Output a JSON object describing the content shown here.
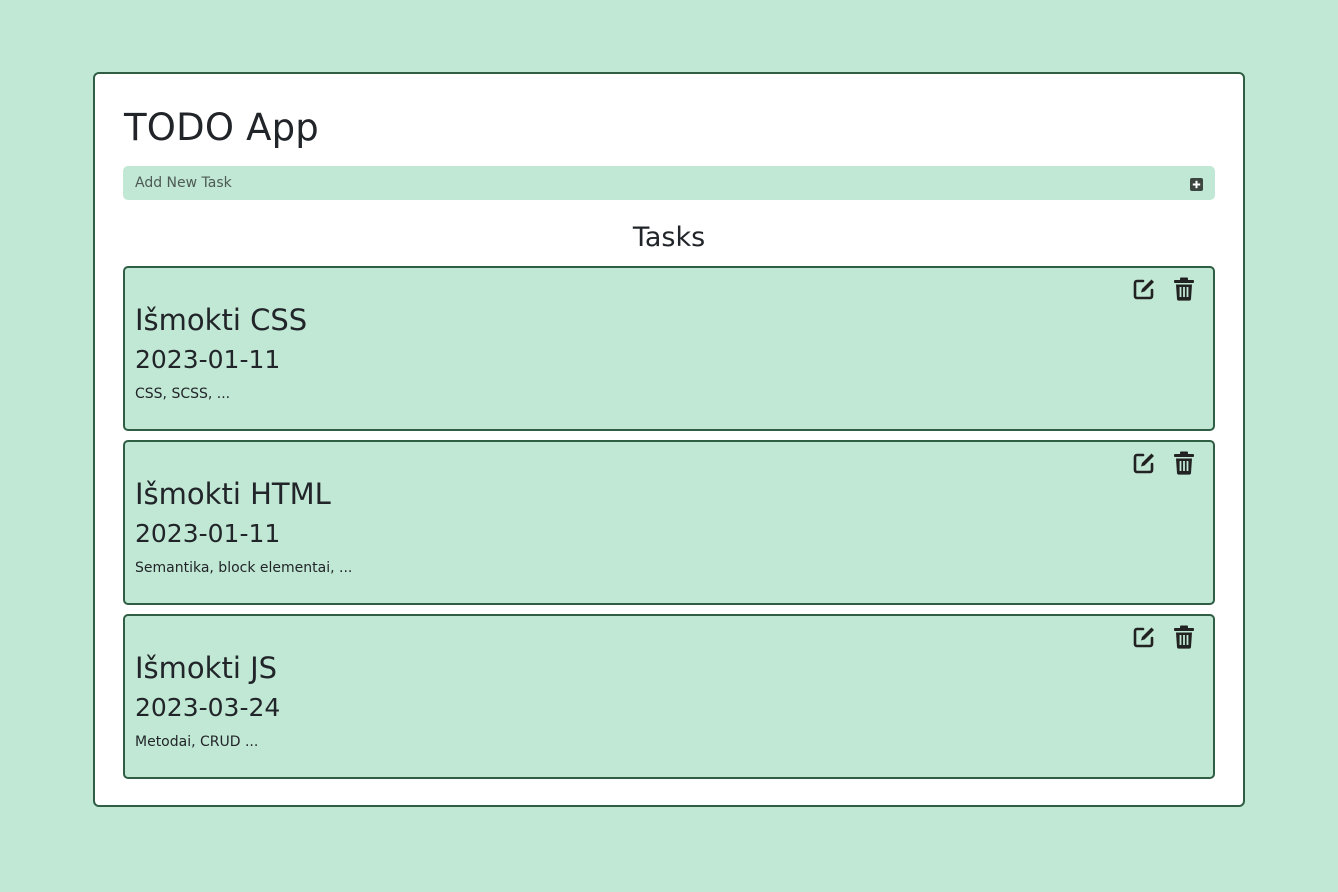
{
  "app": {
    "title": "TODO App"
  },
  "add_task": {
    "label": "Add New Task",
    "icon": "plus-square-icon"
  },
  "tasks_section": {
    "title": "Tasks"
  },
  "tasks": [
    {
      "title": "Išmokti CSS",
      "date": "2023-01-11",
      "description": "CSS, SCSS, ..."
    },
    {
      "title": "Išmokti HTML",
      "date": "2023-01-11",
      "description": "Semantika, block elementai, ..."
    },
    {
      "title": "Išmokti JS",
      "date": "2023-03-24",
      "description": "Metodai, CRUD ..."
    }
  ],
  "task_action_icons": {
    "edit": "edit-icon",
    "delete": "trash-icon"
  },
  "colors": {
    "background": "#c1e8d4",
    "card_border": "#2f5e45",
    "text": "#212529"
  }
}
